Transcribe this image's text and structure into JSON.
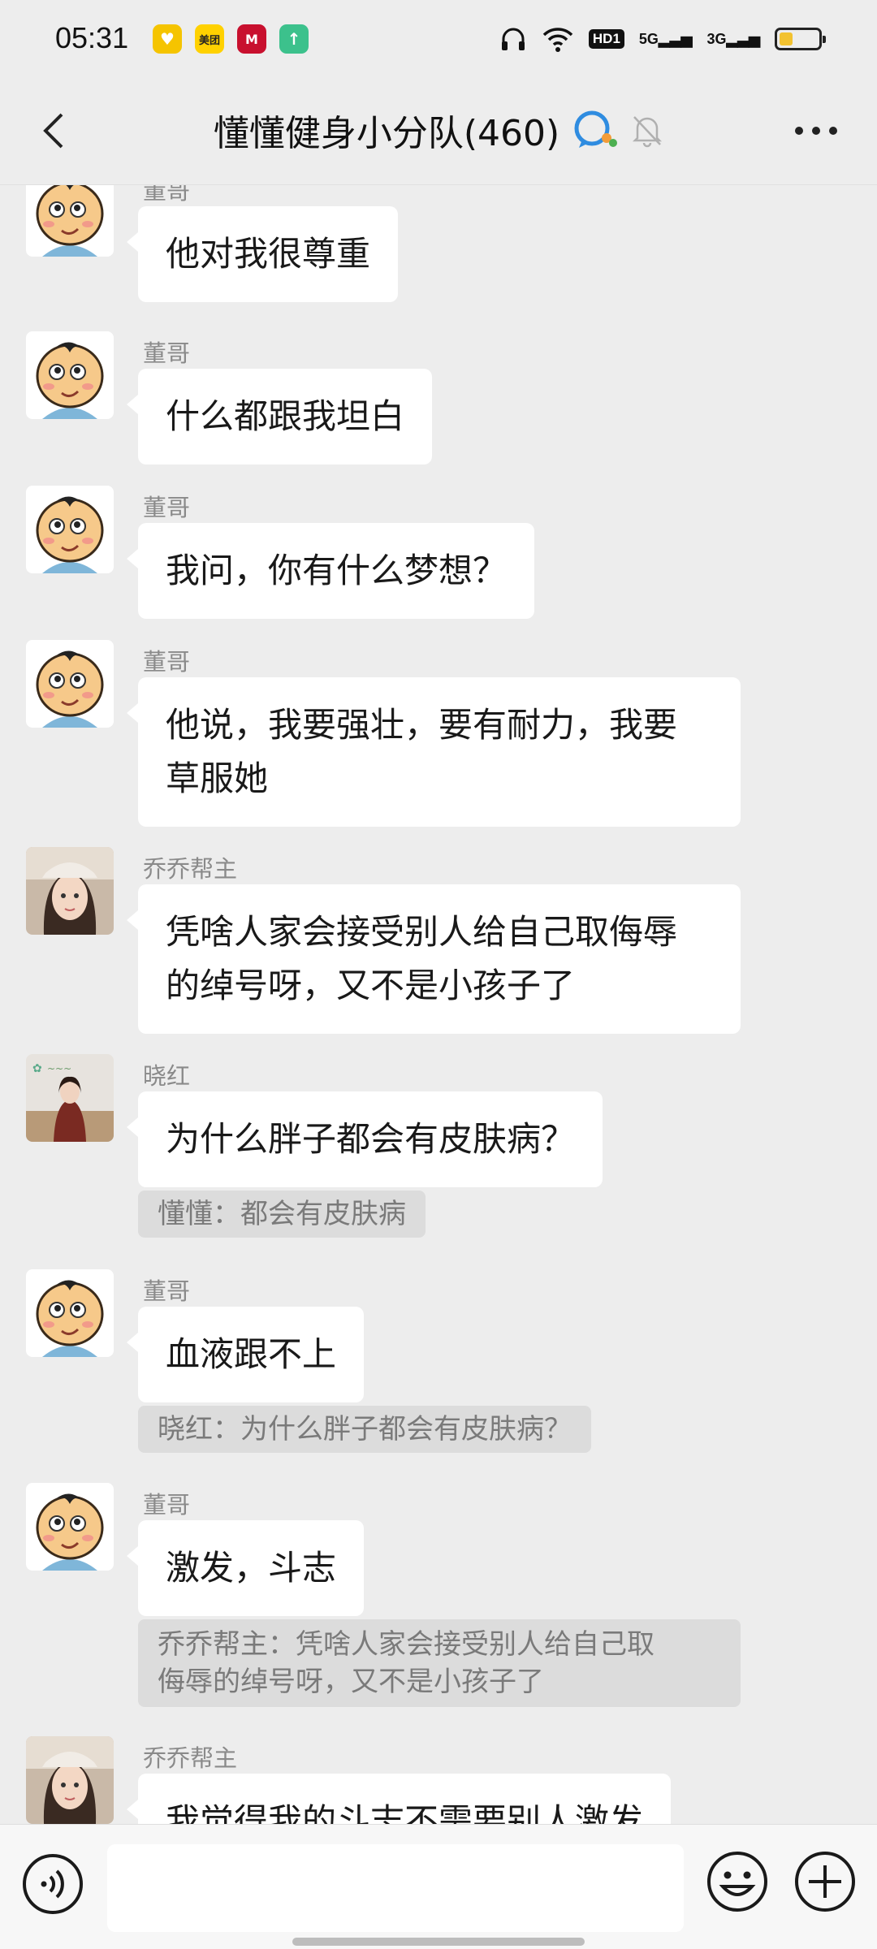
{
  "status_bar": {
    "time": "05:31",
    "app_icons": [
      "wallet-icon",
      "meituan-icon",
      "bank-icon",
      "upload-icon"
    ],
    "meituan_label": "美团",
    "signal_5g": "5G",
    "signal_3g": "3G",
    "hd_label": "HD1",
    "battery_level": 0.35
  },
  "header": {
    "title": "懂懂健身小分队(460)"
  },
  "messages": [
    {
      "sender": "董哥",
      "avatar": "cartoon-boy",
      "text": "他对我很尊重"
    },
    {
      "sender": "董哥",
      "avatar": "cartoon-boy",
      "text": "什么都跟我坦白"
    },
    {
      "sender": "董哥",
      "avatar": "cartoon-boy",
      "text": "我问，你有什么梦想？"
    },
    {
      "sender": "董哥",
      "avatar": "cartoon-boy",
      "text_line1": "他说，我要强壮，要有耐力，我要",
      "text_line2": "草服她"
    },
    {
      "sender": "乔乔帮主",
      "avatar": "girl-cap",
      "text_line1": "凭啥人家会接受别人给自己取侮辱",
      "text_line2": "的绰号呀，又不是小孩子了"
    },
    {
      "sender": "晓红",
      "avatar": "girl-outdoor",
      "text": "为什么胖子都会有皮肤病？",
      "quote": "懂懂：都会有皮肤病"
    },
    {
      "sender": "董哥",
      "avatar": "cartoon-boy",
      "text": "血液跟不上",
      "quote": "晓红：为什么胖子都会有皮肤病？"
    },
    {
      "sender": "董哥",
      "avatar": "cartoon-boy",
      "text": "激发，斗志",
      "quote_line1": "乔乔帮主：凭啥人家会接受别人给自己取",
      "quote_line2": "侮辱的绰号呀，又不是小孩子了"
    },
    {
      "sender": "乔乔帮主",
      "avatar": "girl-cap",
      "text": "我觉得我的斗志不需要别人激发"
    }
  ],
  "colors": {
    "background": "#ededed",
    "bubble": "#ffffff",
    "quote_bg": "#dcdcdc",
    "sender_text": "#8a8a8a"
  }
}
